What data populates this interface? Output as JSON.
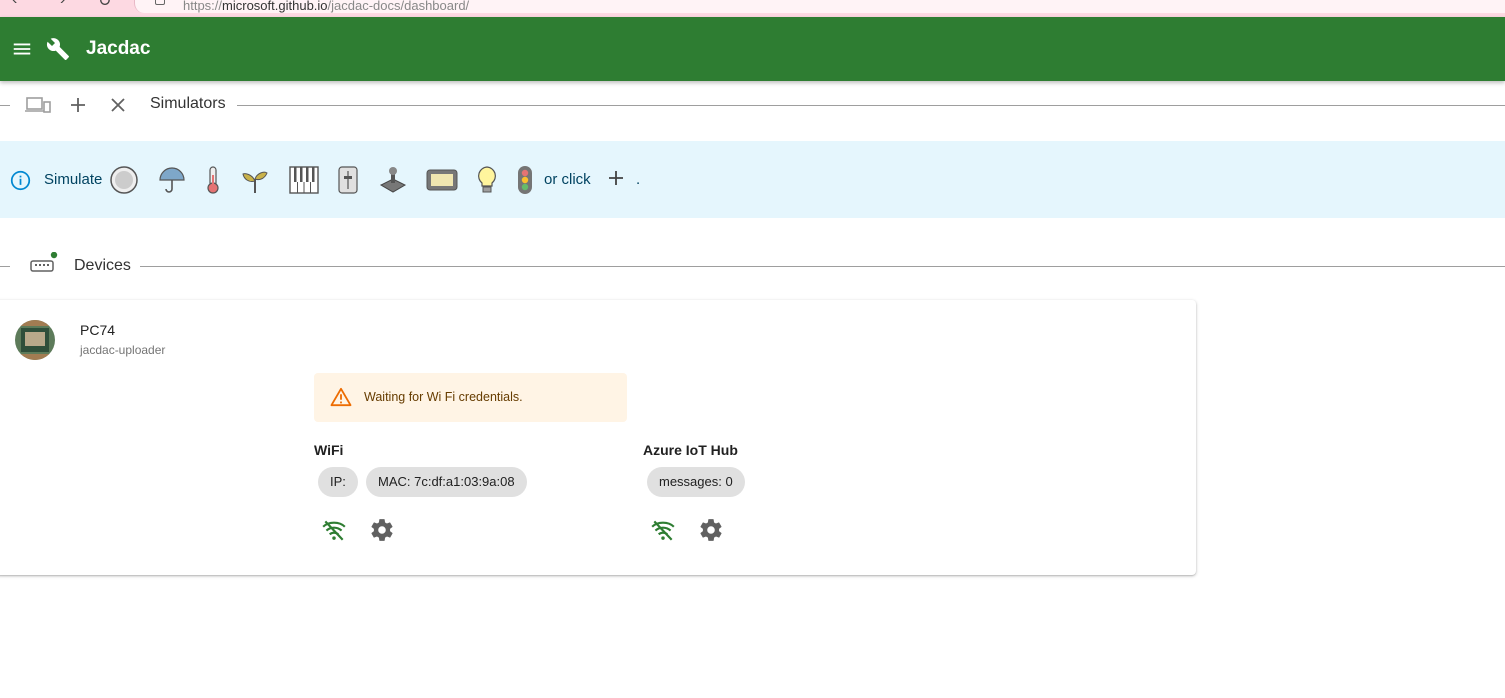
{
  "browser": {
    "url_prefix": "https://",
    "url_host": "microsoft.github.io",
    "url_path": "/jacdac-docs/dashboard/"
  },
  "appbar": {
    "title": "Jacdac",
    "menu_icon": "menu-icon",
    "logo_icon": "wrench-icon",
    "color": "#2e7d32"
  },
  "simulators": {
    "title": "Simulators",
    "toolbar_icons": [
      "devices-icon",
      "add-icon",
      "close-icon"
    ]
  },
  "simulate_banner": {
    "text": "Simulate",
    "or_click": "or click",
    "end": ".",
    "background": "#e5f6fd",
    "devices": [
      "button",
      "rain-gauge",
      "thermometer",
      "soil-moisture",
      "piano",
      "slider",
      "joystick",
      "screen",
      "light-bulb",
      "traffic-light"
    ]
  },
  "devices": {
    "title": "Devices",
    "status_color": "#2e7d32"
  },
  "device": {
    "name": "PC74",
    "subtitle": "jacdac-uploader",
    "alert": "Waiting for Wi Fi credentials.",
    "services": [
      {
        "title": "WiFi",
        "chips": [
          "IP:",
          "MAC: 7c:df:a1:03:9a:08"
        ]
      },
      {
        "title": "Azure IoT Hub",
        "chips": [
          "messages: 0"
        ]
      }
    ]
  }
}
